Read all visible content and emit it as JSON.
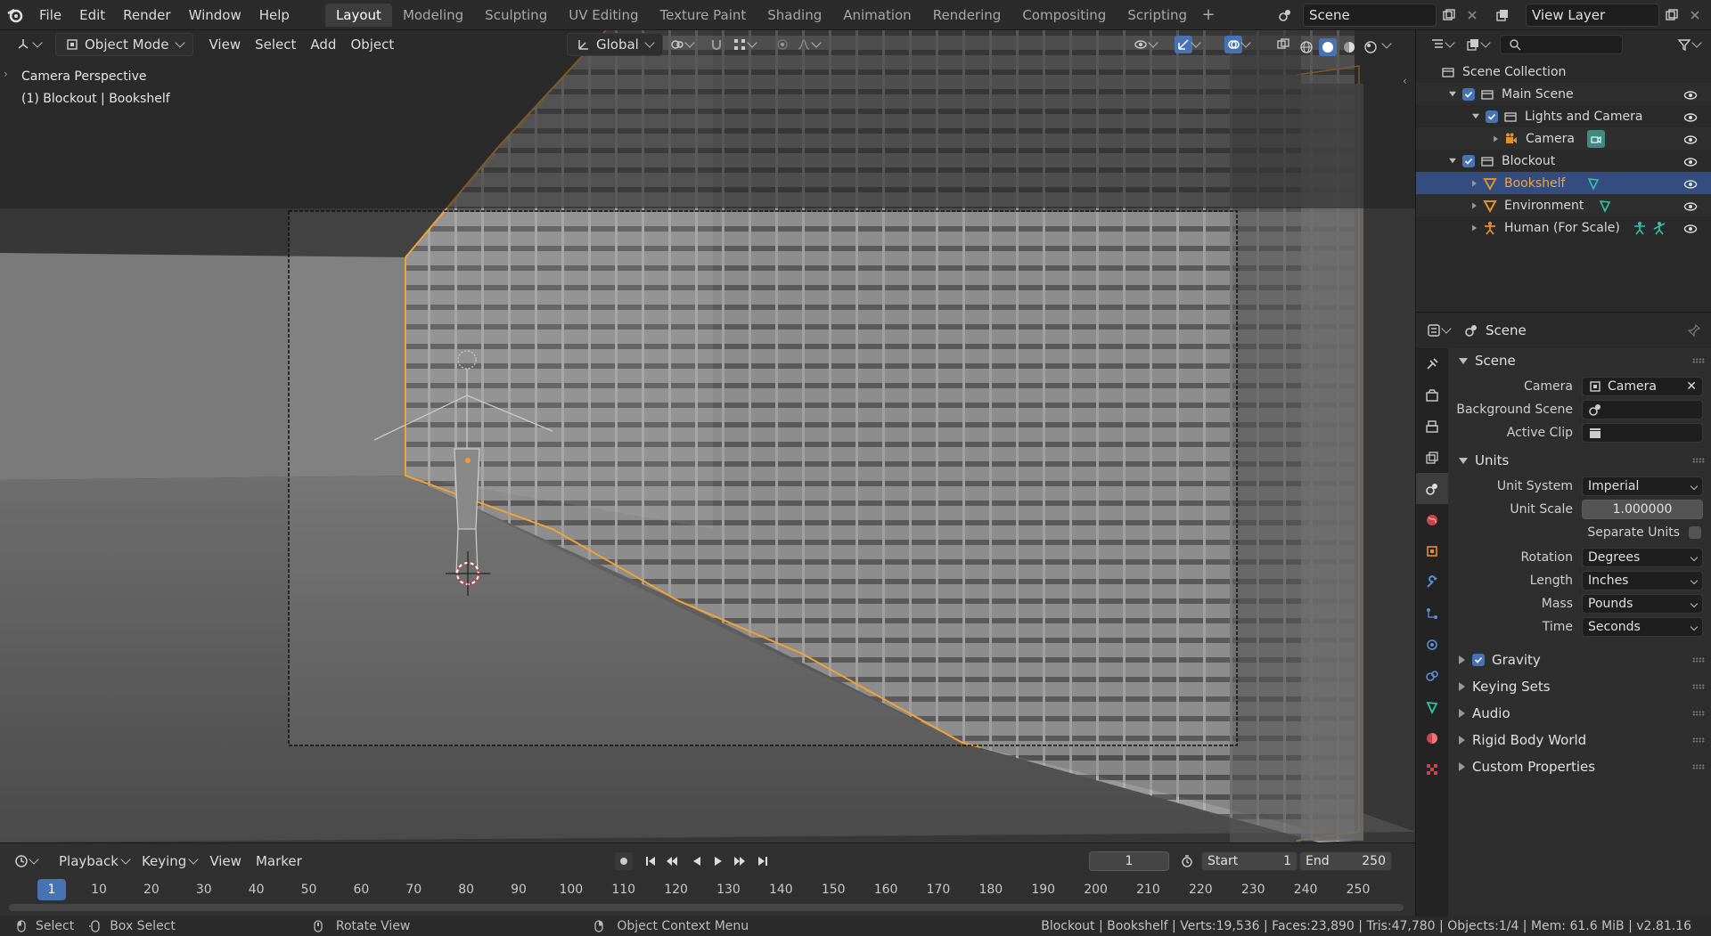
{
  "menu": [
    "File",
    "Edit",
    "Render",
    "Window",
    "Help"
  ],
  "workspaces": [
    "Layout",
    "Modeling",
    "Sculpting",
    "UV Editing",
    "Texture Paint",
    "Shading",
    "Animation",
    "Rendering",
    "Compositing",
    "Scripting"
  ],
  "active_workspace": "Layout",
  "scene_name": "Scene",
  "view_layer": "View Layer",
  "viewport": {
    "mode": "Object Mode",
    "menus": [
      "View",
      "Select",
      "Add",
      "Object"
    ],
    "transform_orientation": "Global",
    "overlay_line1": "Camera Perspective",
    "overlay_line2": "(1) Blockout | Bookshelf"
  },
  "timeline": {
    "menus": [
      "Playback",
      "Keying",
      "View",
      "Marker"
    ],
    "current_frame": "1",
    "start_label": "Start",
    "start": "1",
    "end_label": "End",
    "end": "250",
    "ticks": [
      "1",
      "10",
      "20",
      "30",
      "40",
      "50",
      "60",
      "70",
      "80",
      "90",
      "100",
      "110",
      "120",
      "130",
      "140",
      "150",
      "160",
      "170",
      "180",
      "190",
      "200",
      "210",
      "220",
      "230",
      "240",
      "250"
    ]
  },
  "statusbar": {
    "select": "Select",
    "box_select": "Box Select",
    "rotate": "Rotate View",
    "context": "Object Context Menu",
    "stats": "Blockout | Bookshelf | Verts:19,536 | Faces:23,890 | Tris:47,780 | Objects:1/4 | Mem: 61.6 MiB | v2.81.16"
  },
  "outliner": {
    "items": [
      {
        "label": "Scene Collection"
      },
      {
        "label": "Main Scene"
      },
      {
        "label": "Lights and Camera"
      },
      {
        "label": "Camera"
      },
      {
        "label": "Blockout"
      },
      {
        "label": "Bookshelf"
      },
      {
        "label": "Environment"
      },
      {
        "label": "Human (For Scale)"
      }
    ]
  },
  "properties": {
    "context": "Scene",
    "scene_panel": "Scene",
    "camera_label": "Camera",
    "camera_value": "Camera",
    "bg_scene_label": "Background Scene",
    "active_clip_label": "Active Clip",
    "units_panel": "Units",
    "unit_system_label": "Unit System",
    "unit_system": "Imperial",
    "unit_scale_label": "Unit Scale",
    "unit_scale": "1.000000",
    "separate_units_label": "Separate Units",
    "rotation_label": "Rotation",
    "rotation": "Degrees",
    "length_label": "Length",
    "length": "Inches",
    "mass_label": "Mass",
    "mass": "Pounds",
    "time_label": "Time",
    "time": "Seconds",
    "gravity": "Gravity",
    "keying_sets": "Keying Sets",
    "audio": "Audio",
    "rigid_body": "Rigid Body World",
    "custom_props": "Custom Properties"
  },
  "colors": {
    "accent": "#4772b3",
    "selection_orange": "#f29c2b",
    "selected_row": "#334d80"
  }
}
